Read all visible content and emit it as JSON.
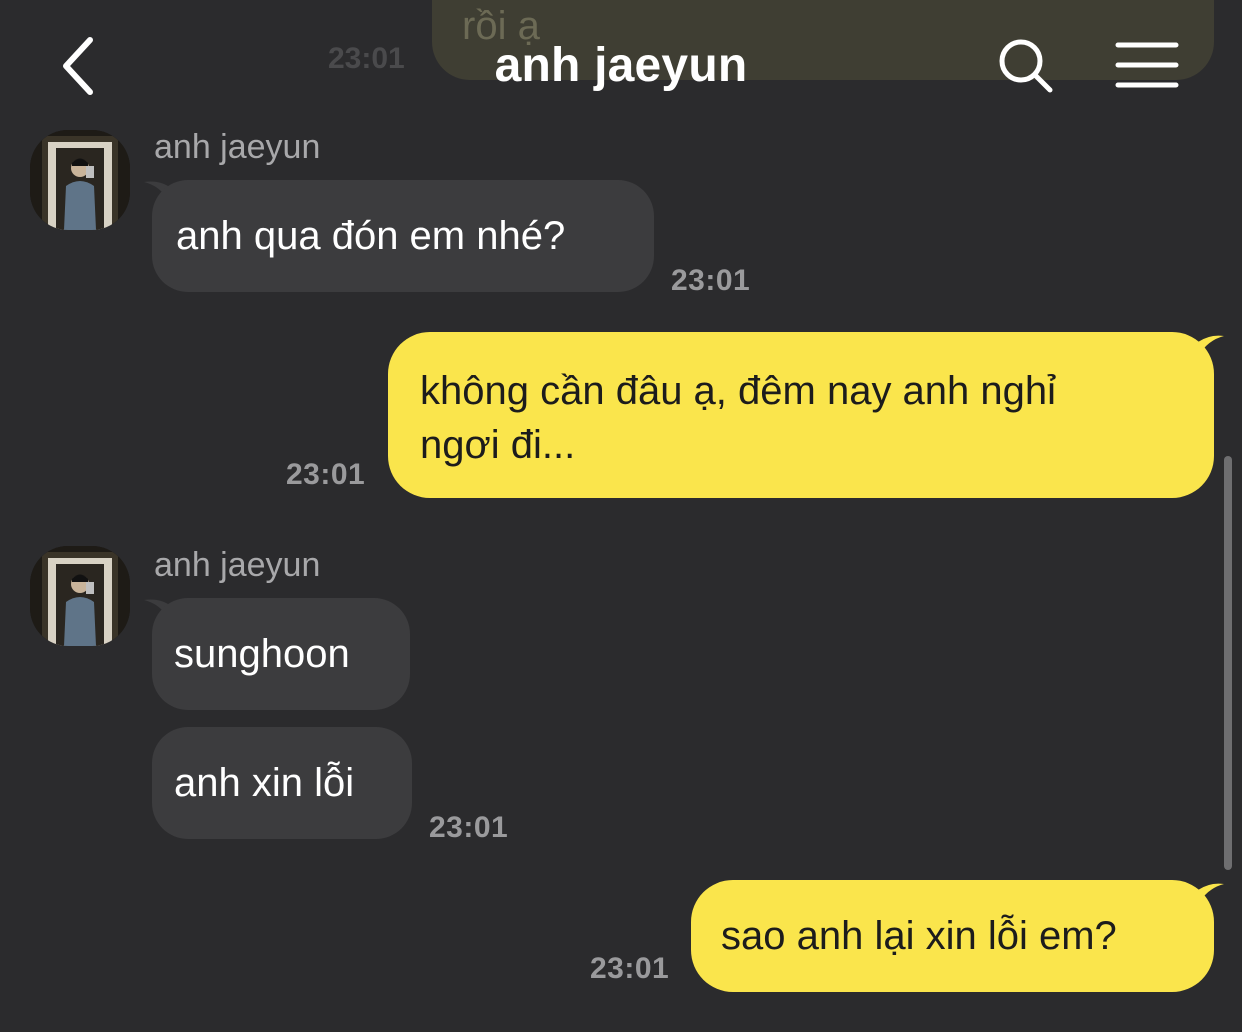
{
  "header": {
    "title": "anh jaeyun"
  },
  "ghost_message": {
    "text": "rồi ạ",
    "time": "23:01"
  },
  "messages": [
    {
      "sender": "anh jaeyun",
      "text": "anh qua đón em nhé?",
      "time": "23:01"
    },
    {
      "text_line1": "không cần đâu ạ, đêm nay anh nghỉ",
      "text_line2": "ngơi đi...",
      "time": "23:01"
    },
    {
      "sender": "anh jaeyun",
      "text1": "sunghoon",
      "text2": "anh xin lỗi",
      "time": "23:01"
    },
    {
      "text": "sao anh lại xin lỗi em?",
      "time": "23:01"
    }
  ],
  "icons": {
    "back": "chevron-left-icon",
    "search": "search-icon",
    "menu": "hamburger-menu-icon"
  },
  "colors": {
    "background": "#2b2b2d",
    "incoming_bubble": "#3c3c3e",
    "outgoing_bubble": "#fae54c"
  }
}
